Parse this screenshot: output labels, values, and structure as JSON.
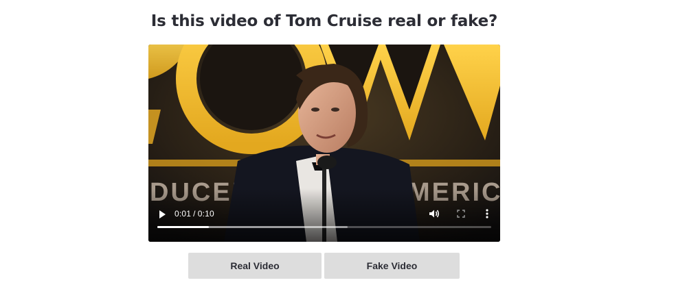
{
  "question": {
    "title": "Is this video of Tom Cruise real or fake?"
  },
  "video": {
    "current_time": "0:01",
    "separator": "/",
    "duration": "0:10",
    "played_fraction": 0.155,
    "buffered_fraction": 0.57,
    "backdrop_text_left": "DUCERS",
    "backdrop_text_right": "MERICA",
    "icons": {
      "play": "play-icon",
      "volume": "volume-icon",
      "fullscreen": "fullscreen-icon",
      "more": "more-options-icon"
    }
  },
  "answers": {
    "real_label": "Real Video",
    "fake_label": "Fake Video"
  },
  "colors": {
    "title_text": "#2c2d35",
    "button_bg": "#dddddd",
    "backdrop_glow": "#f2c233",
    "player_bg": "#0b0b0d"
  }
}
